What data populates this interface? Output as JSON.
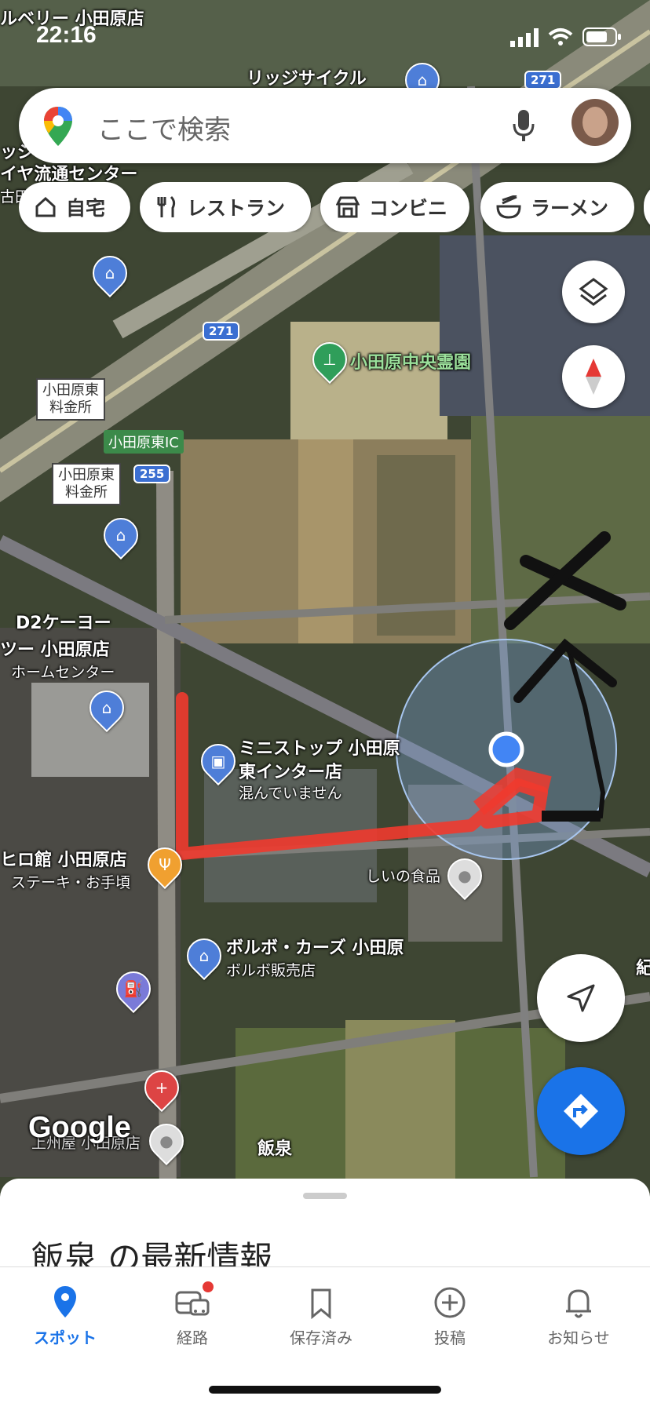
{
  "status_bar": {
    "time": "22:16"
  },
  "search": {
    "placeholder": "ここで検索"
  },
  "chips": [
    {
      "label": "自宅",
      "icon": "home-icon"
    },
    {
      "label": "レストラン",
      "icon": "restaurant-icon"
    },
    {
      "label": "コンビニ",
      "icon": "store-icon"
    },
    {
      "label": "ラーメン",
      "icon": "ramen-icon"
    }
  ],
  "map": {
    "labels": {
      "berry": "ルベリー 小田原店",
      "ridge": "リッジサイクル",
      "tire1": "ッジ",
      "tire2": "イヤ流通センター",
      "tire3": "古田原店",
      "cemetery": "小田原中央霊園",
      "tollbooth1": "小田原東\n料金所",
      "tollbooth2": "小田原東\n料金所",
      "ic": "小田原東IC",
      "d2_1": "D2ケーヨー",
      "d2_2": "ツー 小田原店",
      "d2_3": "ホームセンター",
      "ministop_1": "ミニストップ 小田原",
      "ministop_2": "東インター店",
      "ministop_3": "混んでいません",
      "hiro_1": "ヒロ館 小田原店",
      "hiro_2": "ステーキ・お手頃",
      "shiino": "しいの食品",
      "volvo_1": "ボルボ・カーズ 小田原",
      "volvo_2": "ボルボ販売店",
      "iizumi": "飯泉",
      "sakura": "上州屋 小田原店",
      "google": "Google",
      "edge": "紀"
    },
    "roads": [
      "271",
      "271",
      "255"
    ]
  },
  "sheet": {
    "title": "飯泉 の最新情報"
  },
  "tabs": [
    {
      "label": "スポット",
      "active": true
    },
    {
      "label": "経路",
      "active": false
    },
    {
      "label": "保存済み",
      "active": false
    },
    {
      "label": "投稿",
      "active": false
    },
    {
      "label": "お知らせ",
      "active": false
    }
  ],
  "colors": {
    "accent": "#1a73e8",
    "route_red": "#f03a2e",
    "scribble": "#111111"
  }
}
